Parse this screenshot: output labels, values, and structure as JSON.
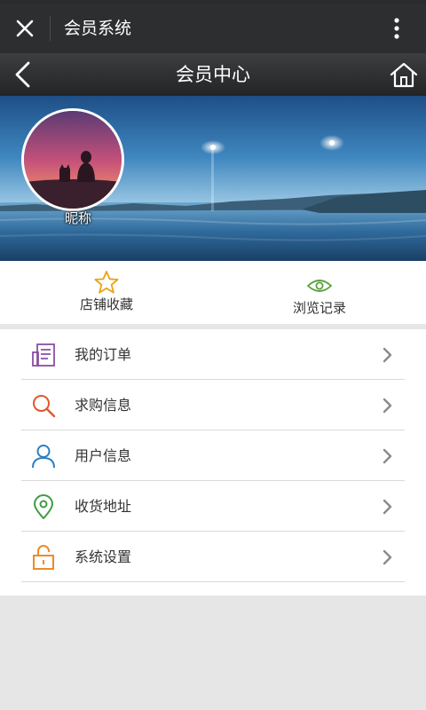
{
  "wechat_bar": {
    "title": "会员系统",
    "close_icon": "close-icon",
    "more_icon": "more-vertical-icon"
  },
  "nav": {
    "title": "会员中心",
    "back_icon": "chevron-left-icon",
    "home_icon": "home-icon"
  },
  "profile": {
    "nickname": "昵称"
  },
  "quick_actions": [
    {
      "label": "店铺收藏",
      "icon": "star-icon",
      "color": "#e8a317"
    },
    {
      "label": "浏览记录",
      "icon": "eye-icon",
      "color": "#5aa23a"
    }
  ],
  "menu": [
    {
      "label": "我的订单",
      "icon": "receipt-icon",
      "color": "#8a4fa6"
    },
    {
      "label": "求购信息",
      "icon": "search-icon",
      "color": "#e2562b"
    },
    {
      "label": "用户信息",
      "icon": "user-icon",
      "color": "#2b7fc4"
    },
    {
      "label": "收货地址",
      "icon": "location-pin-icon",
      "color": "#3f9b45"
    },
    {
      "label": "系统设置",
      "icon": "unlock-icon",
      "color": "#ee8a2a"
    }
  ],
  "colors": {
    "top_bar": "#2d2e30",
    "page_background": "#e6e6e6",
    "chevron": "#8a8a8a"
  }
}
